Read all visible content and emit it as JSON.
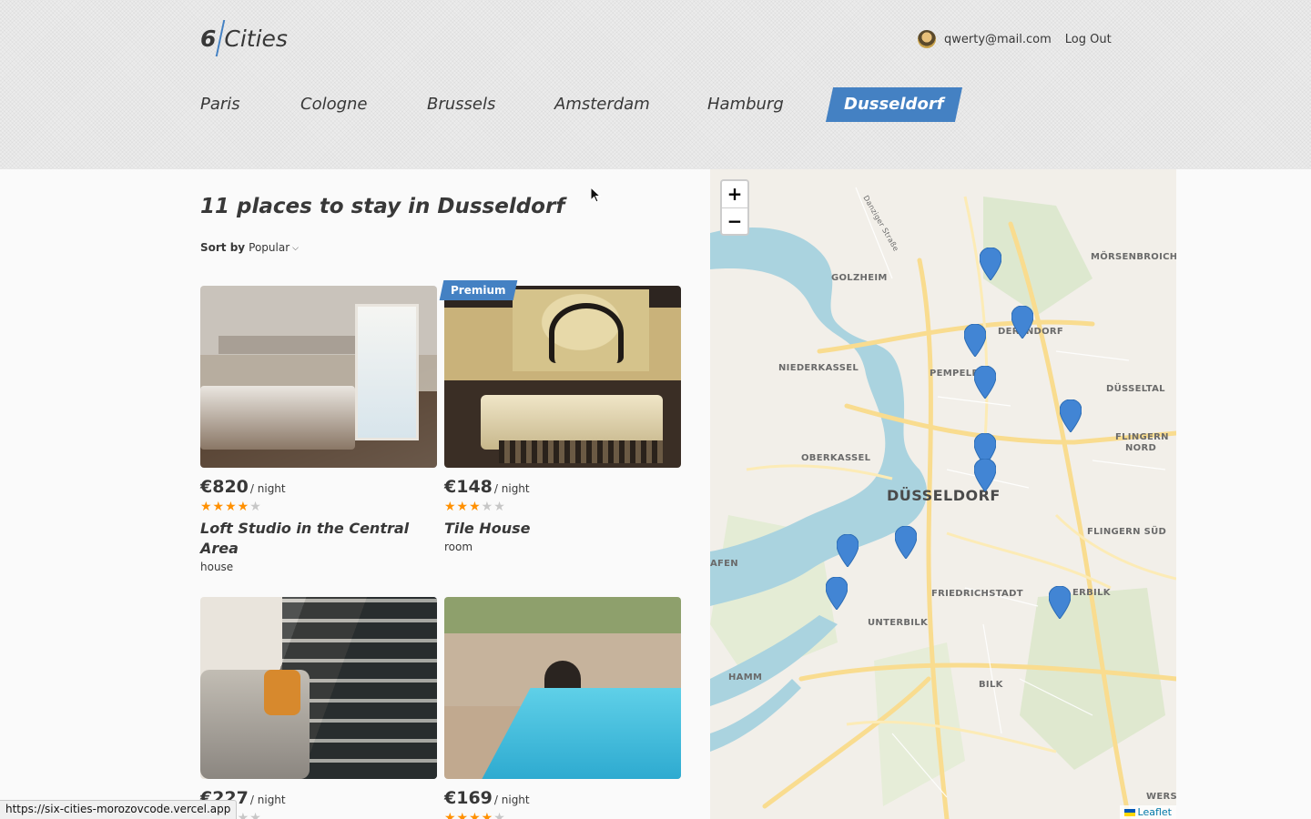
{
  "header": {
    "logo_number": "6",
    "logo_text": "Cities",
    "user_email": "qwerty@mail.com",
    "logout_label": "Log Out"
  },
  "tabs": [
    {
      "label": "Paris",
      "active": false
    },
    {
      "label": "Cologne",
      "active": false
    },
    {
      "label": "Brussels",
      "active": false
    },
    {
      "label": "Amsterdam",
      "active": false
    },
    {
      "label": "Hamburg",
      "active": false
    },
    {
      "label": "Dusseldorf",
      "active": true
    }
  ],
  "places": {
    "title": "11 places to stay in Dusseldorf",
    "sort_label": "Sort by",
    "sort_value": "Popular"
  },
  "offers": [
    {
      "price": "€820",
      "per": "/ night",
      "rating": 4,
      "name": "Loft Studio in the Central Area",
      "type": "house",
      "premium": false
    },
    {
      "price": "€148",
      "per": "/ night",
      "rating": 3,
      "name": "Tile House",
      "type": "room",
      "premium": true,
      "premium_label": "Premium"
    },
    {
      "price": "€227",
      "per": "/ night",
      "rating": 2,
      "premium": false
    },
    {
      "price": "€169",
      "per": "/ night",
      "rating": 4,
      "premium": false
    }
  ],
  "map": {
    "zoom_in": "+",
    "zoom_out": "−",
    "attribution": "Leaflet",
    "labels": {
      "golzheim": "GOLZHEIM",
      "morsenbroich": "MÖRSENBROICH",
      "derendorf": "DERENDORF",
      "niederkassel": "NIEDERKASSEL",
      "pempelfort": "PEMPELF",
      "dusseltal": "DÜSSELTAL",
      "flingern_nord_1": "FLINGERN",
      "flingern_nord_2": "NORD",
      "oberkassel": "OBERKASSEL",
      "dusseldorf": "DÜSSELDORF",
      "flingern_sud": "FLINGERN SÜD",
      "hafen": "AFEN",
      "friedrichstadt": "FRIEDRICHSTADT",
      "oberbilk": "ERBILK",
      "unterbilk": "UNTERBILK",
      "hamm": "HAMM",
      "bilk": "BILK",
      "wersten": "WERSTE",
      "street": "Danziger Straße"
    },
    "pins": 11
  },
  "status_url": "https://six-cities-morozovcode.vercel.app"
}
